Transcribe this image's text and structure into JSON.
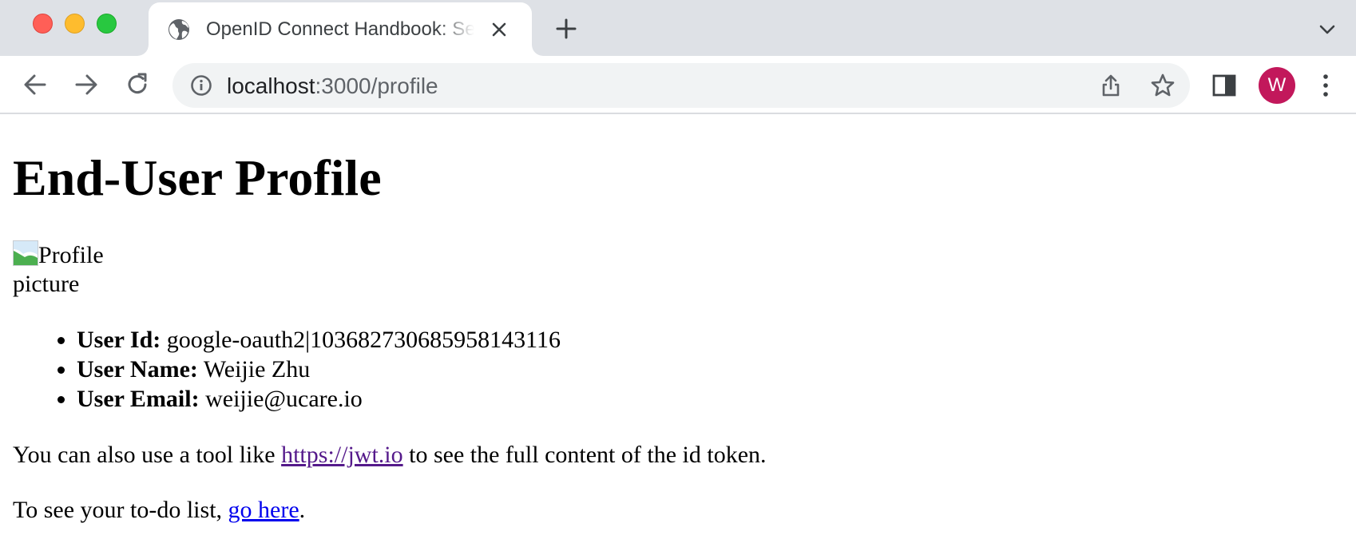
{
  "browser": {
    "tab": {
      "title": "OpenID Connect Handbook: Se"
    },
    "address_bar": {
      "host": "localhost",
      "rest": ":3000/profile"
    },
    "profile_avatar_letter": "W",
    "colors": {
      "tabstrip_bg": "#dee1e6",
      "omnibox_bg": "#f1f3f4",
      "avatar_bg": "#c2185b",
      "link": "#0000ee",
      "visited_link": "#551a8b"
    }
  },
  "page": {
    "title": "End-User Profile",
    "profile_image_alt": "Profile picture",
    "profile": [
      {
        "label": "User Id:",
        "value": " google-oauth2|103682730685958143116"
      },
      {
        "label": "User Name:",
        "value": " Weijie Zhu"
      },
      {
        "label": "User Email:",
        "value": " weijie@ucare.io"
      }
    ],
    "jwt_text_before": "You can also use a tool like ",
    "jwt_link": "https://jwt.io",
    "jwt_text_after": " to see the full content of the id token.",
    "todo_text_before": "To see your to-do list, ",
    "todo_link": "go here",
    "todo_text_after": "."
  }
}
